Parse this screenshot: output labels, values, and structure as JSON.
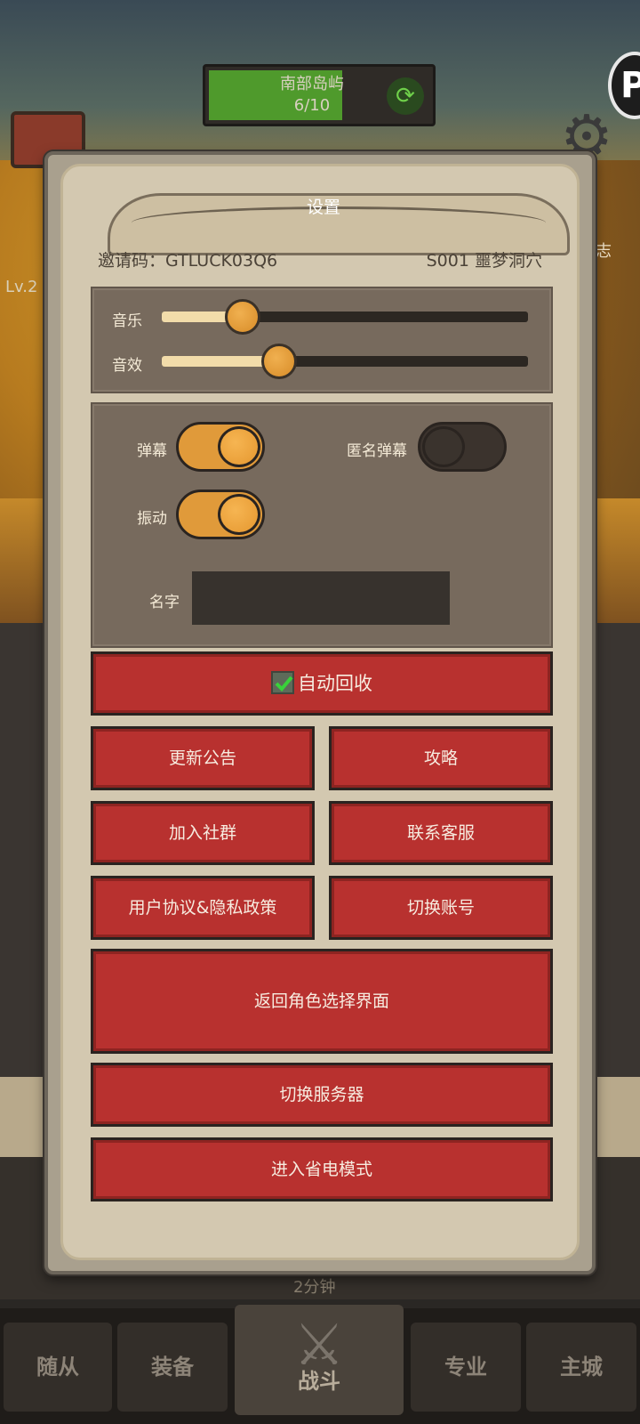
{
  "background": {
    "location_name": "南部岛屿",
    "location_progress": "6/10",
    "bottom_hint": "2分钟",
    "side_label_log": "日志",
    "level_label": "Lv.2"
  },
  "bottom_nav": {
    "tabs": [
      "随从",
      "装备",
      "战斗",
      "专业",
      "主城"
    ]
  },
  "dialog": {
    "title": "设置",
    "invite_label": "邀请码：GTLUCK03Q6",
    "server": "S001 噩梦洞穴",
    "audio": {
      "music_label": "音乐",
      "music_level": 0.22,
      "sfx_label": "音效",
      "sfx_level": 0.32
    },
    "toggles": {
      "danmaku_label": "弹幕",
      "danmaku_on": true,
      "anonymous_danmaku_label": "匿名弹幕",
      "anonymous_danmaku_on": false,
      "vibration_label": "振动",
      "vibration_on": true
    },
    "name_label": "名字",
    "auto_recycle_label": "自动回收",
    "auto_recycle_checked": true,
    "buttons": {
      "update_notice": "更新公告",
      "guide": "攻略",
      "join_community": "加入社群",
      "contact_service": "联系客服",
      "user_agreement": "用户协议&隐私政策",
      "switch_account": "切换账号",
      "return_character_select": "返回角色选择界面",
      "switch_server": "切换服务器",
      "power_saving": "进入省电模式"
    }
  },
  "colors": {
    "button_red": "#b8312f",
    "panel_brown": "#776a5d",
    "toggle_on": "#e09a3a",
    "parchment": "#d3c8b0"
  }
}
